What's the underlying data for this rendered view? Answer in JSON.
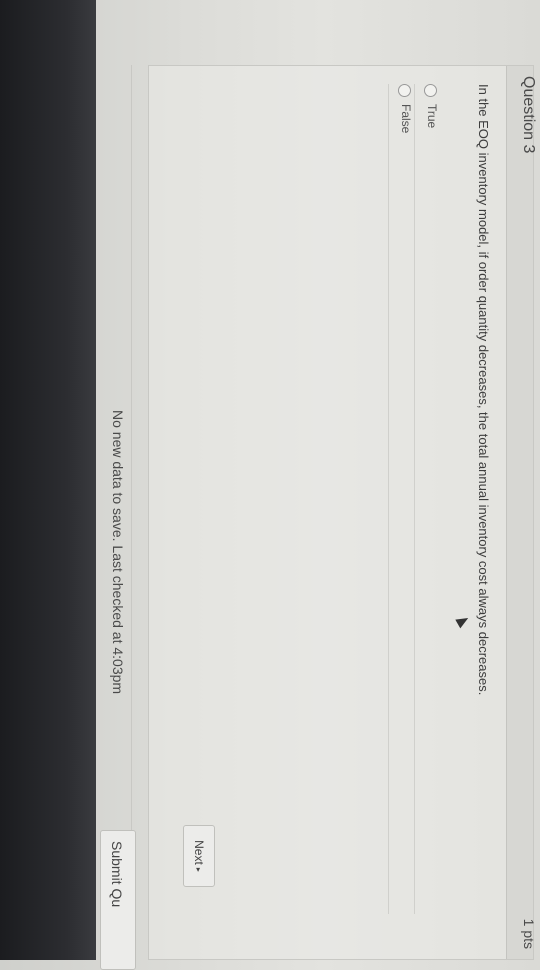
{
  "question": {
    "title": "Question 3",
    "points": "1 pts",
    "text": "In the EOQ inventory model, if order quantity decreases, the total annual inventory cost always decreases.",
    "answers": [
      {
        "label": "True",
        "selected": false
      },
      {
        "label": "False",
        "selected": false
      }
    ]
  },
  "navigation": {
    "next_label": "Next"
  },
  "footer": {
    "status": "No new data to save. Last checked at 4:03pm",
    "submit_label": "Submit Qu"
  }
}
